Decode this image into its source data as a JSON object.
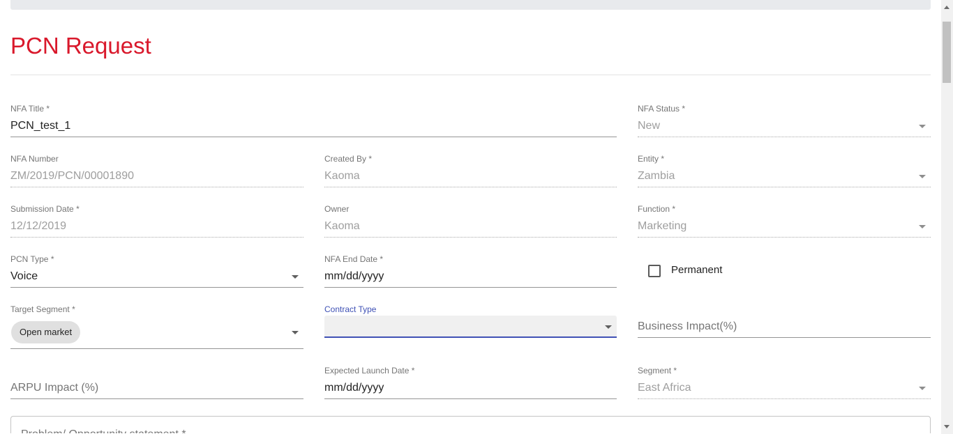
{
  "page": {
    "title": "PCN Request"
  },
  "fields": {
    "nfa_title": {
      "label": "NFA Title",
      "required": "*",
      "value": "PCN_test_1"
    },
    "nfa_status": {
      "label": "NFA Status",
      "required": "*",
      "value": "New"
    },
    "nfa_number": {
      "label": "NFA Number",
      "value": "ZM/2019/PCN/00001890"
    },
    "created_by": {
      "label": "Created By",
      "required": "*",
      "value": "Kaoma"
    },
    "entity": {
      "label": "Entity",
      "required": "*",
      "value": "Zambia"
    },
    "submission_date": {
      "label": "Submission Date",
      "required": "*",
      "value": "12/12/2019"
    },
    "owner": {
      "label": "Owner",
      "value": "Kaoma"
    },
    "function": {
      "label": "Function",
      "required": "*",
      "value": "Marketing"
    },
    "pcn_type": {
      "label": "PCN Type",
      "required": "*",
      "value": "Voice"
    },
    "nfa_end_date": {
      "label": "NFA End Date",
      "required": "*",
      "value": "mm/dd/yyyy"
    },
    "permanent": {
      "label": "Permanent"
    },
    "target_segment": {
      "label": "Target Segment",
      "required": "*",
      "chip": "Open market"
    },
    "contract_type": {
      "label": "Contract Type",
      "value": ""
    },
    "business_impact": {
      "placeholder": "Business Impact(%)"
    },
    "arpu_impact": {
      "placeholder": "ARPU Impact (%)"
    },
    "expected_launch_date": {
      "label": "Expected Launch Date",
      "required": "*",
      "value": "mm/dd/yyyy"
    },
    "segment": {
      "label": "Segment",
      "required": "*",
      "value": "East Africa"
    },
    "problem_statement": {
      "label": "Problem/ Opportunity statement *"
    }
  }
}
